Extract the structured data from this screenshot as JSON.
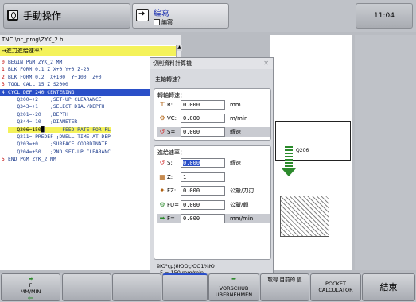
{
  "header": {
    "mode_main": "手動操作",
    "mode_edit_title": "編寫",
    "mode_edit_sub": "編寫",
    "clock": "11:04"
  },
  "program": {
    "path": "TNC:\\nc_prog\\ZYK_2.h",
    "prompt": "→進刀進給速率？",
    "lines": [
      {
        "n": "0",
        "t": "BEGIN PGM ZYK_2 MM"
      },
      {
        "n": "1",
        "t": "BLK FORM 0.1 Z X+0 Y+0 Z-20"
      },
      {
        "n": "2",
        "t": "BLK FORM 0.2  X+100  Y+100  Z+0"
      },
      {
        "n": "3",
        "t": "TOOL CALL 15 Z S2000"
      },
      {
        "n": "4",
        "t": "CYCL DEF 240 CENTERING"
      },
      {
        "n": "",
        "t": "   Q200=+2    ;SET-UP CLEARANCE"
      },
      {
        "n": "",
        "t": "   Q343=+1    ;SELECT DIA./DEPTH"
      },
      {
        "n": "",
        "t": "   Q201=-20   ;DEPTH"
      },
      {
        "n": "",
        "t": "   Q344=-10   ;DIAMETER"
      },
      {
        "n": "",
        "t_pre": "   Q206=150",
        "t_post": "      FEED RATE FOR PL"
      },
      {
        "n": "",
        "t": "   Q211= PREDEF ;DWELL TIME AT DEP"
      },
      {
        "n": "",
        "t": "   Q203=+0    ;SURFACE COORDINATE"
      },
      {
        "n": "",
        "t": "   Q204=+50   ;2ND SET-UP CLEARANC"
      },
      {
        "n": "5",
        "t": "END PGM ZYK_2 MM"
      }
    ]
  },
  "graphic": {
    "label": "Q206"
  },
  "dialog": {
    "title": "切削資料計算機",
    "close_icon": "close-icon",
    "question": "主軸轉速？",
    "speed_group": {
      "heading": "轉軸轉速：",
      "rows": [
        {
          "icon": "tool-radius-icon",
          "glyph": "𝕋",
          "label": "R:",
          "value": "0.000",
          "unit": "mm"
        },
        {
          "icon": "cutting-speed-icon",
          "glyph": "⚙",
          "label": "VC:",
          "value": "0.000",
          "unit": "m/min"
        },
        {
          "icon": "spindle-icon",
          "glyph": "↺",
          "label": "S=",
          "value": "0.000",
          "unit": "轉速"
        }
      ]
    },
    "feed_group": {
      "heading": "進給速率：",
      "rows": [
        {
          "icon": "spindle-icon",
          "glyph": "↺",
          "label": "S:",
          "value": "0.000",
          "unit": "轉速"
        },
        {
          "icon": "teeth-icon",
          "glyph": "▦",
          "label": "Z:",
          "value": "1",
          "unit": ""
        },
        {
          "icon": "feed-per-tooth-icon",
          "glyph": "✦",
          "label": "FZ:",
          "value": "0.000",
          "unit": "公釐/刀刃"
        },
        {
          "icon": "feed-per-rev-icon",
          "glyph": "⚙",
          "label": "FU=",
          "value": "0.000",
          "unit": "公釐/轉"
        },
        {
          "icon": "feed-icon",
          "glyph": "➡",
          "label": "F=",
          "value": "0.000",
          "unit": "mm/min"
        }
      ]
    },
    "result_line1": "ёЮ³çµ¦ёЮОçЮО1¾Ю",
    "result_line2": "  F = 150 mm/min"
  },
  "softkeys": [
    {
      "top": "F",
      "label": "MM/MIN"
    },
    {
      "top": "",
      "label": ""
    },
    {
      "top": "",
      "label": ""
    },
    {
      "top": "",
      "label": ""
    },
    {
      "top": "➡",
      "label": "VORSCHUB ÜBERNEHMEN"
    },
    {
      "top": "",
      "label": "取得 目前的 值"
    },
    {
      "top": "",
      "label": "POCKET CALCULATOR"
    },
    {
      "top": "",
      "label": "結束"
    }
  ]
}
